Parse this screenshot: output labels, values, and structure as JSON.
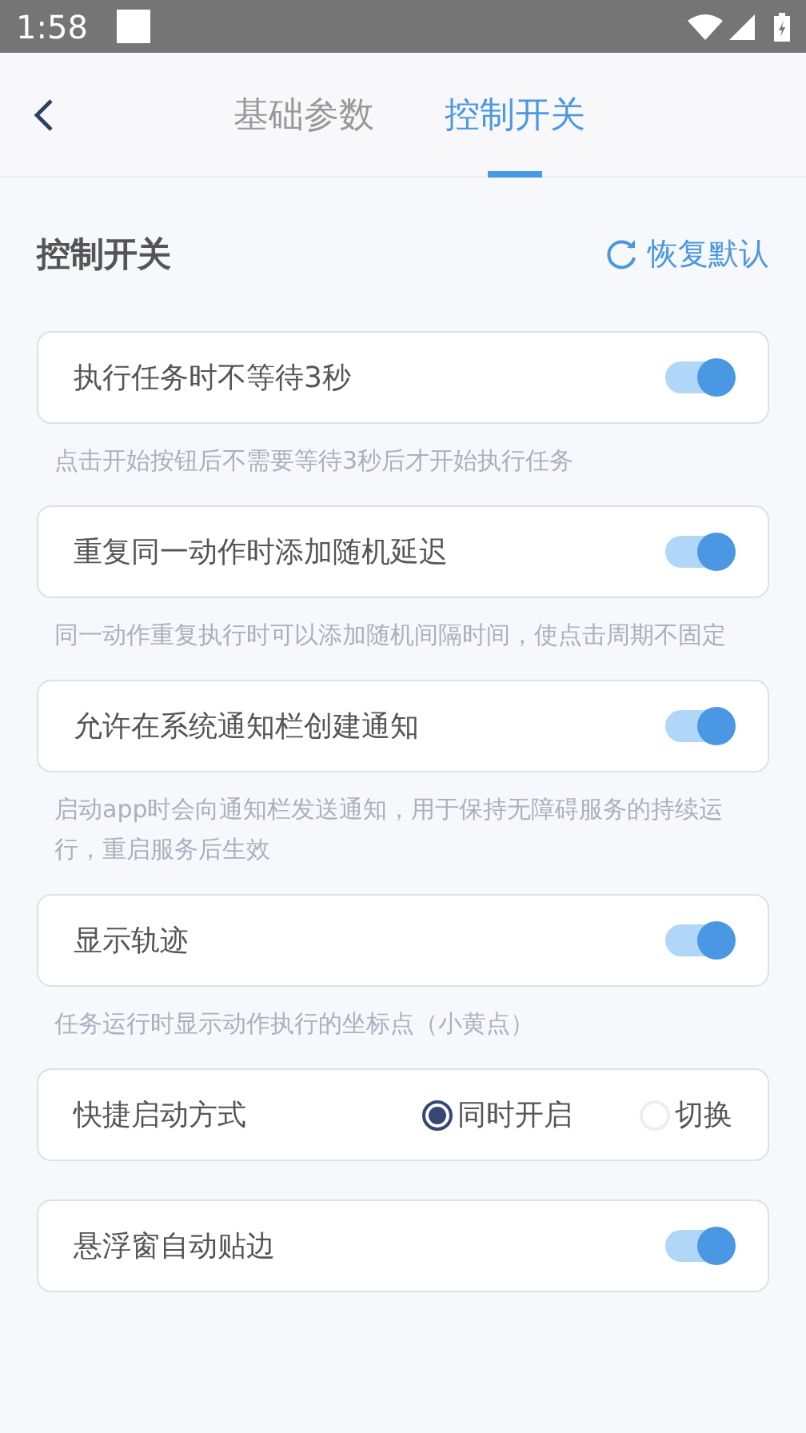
{
  "status_bar": {
    "time": "1:58"
  },
  "tabs": [
    {
      "label": "基础参数",
      "selected": false
    },
    {
      "label": "控制开关",
      "selected": true
    }
  ],
  "section": {
    "title": "控制开关",
    "reset_label": "恢复默认"
  },
  "settings": [
    {
      "kind": "toggle",
      "label": "执行任务时不等待3秒",
      "on": true,
      "hint": "点击开始按钮后不需要等待3秒后才开始执行任务"
    },
    {
      "kind": "toggle",
      "label": "重复同一动作时添加随机延迟",
      "on": true,
      "hint": "同一动作重复执行时可以添加随机间隔时间，使点击周期不固定"
    },
    {
      "kind": "toggle",
      "label": "允许在系统通知栏创建通知",
      "on": true,
      "hint": "启动app时会向通知栏发送通知，用于保持无障碍服务的持续运行，重启服务后生效"
    },
    {
      "kind": "toggle",
      "label": "显示轨迹",
      "on": true,
      "hint": "任务运行时显示动作执行的坐标点（小黄点）"
    },
    {
      "kind": "radio",
      "label": "快捷启动方式",
      "options": [
        {
          "label": "同时开启",
          "selected": true
        },
        {
          "label": "切换",
          "selected": false
        }
      ]
    },
    {
      "kind": "toggle",
      "label": "悬浮窗自动贴边",
      "on": true
    }
  ]
}
